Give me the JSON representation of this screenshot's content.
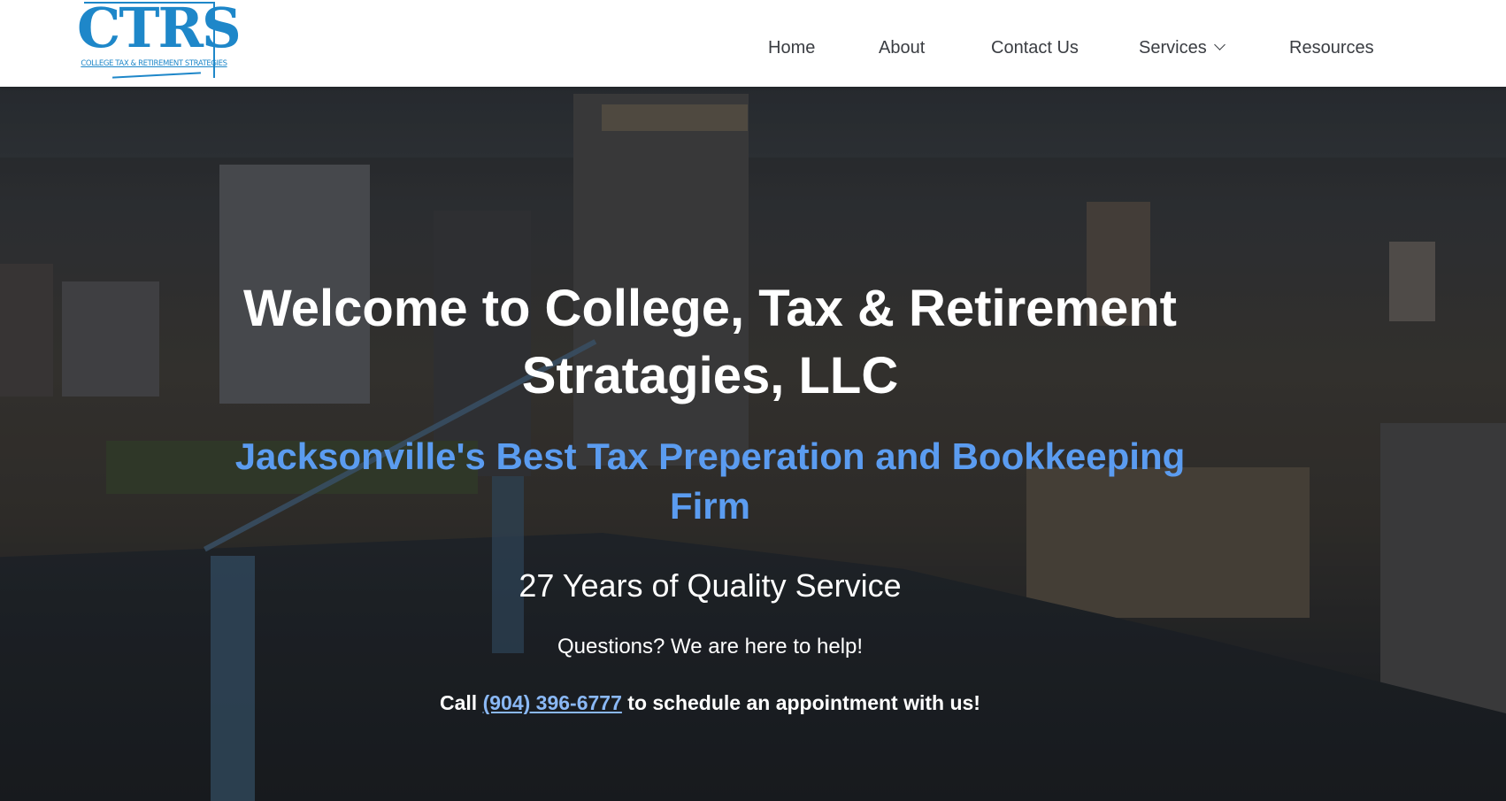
{
  "header": {
    "logo": {
      "text": "CTRS",
      "subtext": "COLLEGE TAX & RETIREMENT STRATEGIES"
    },
    "nav": [
      {
        "label": "Home"
      },
      {
        "label": "About"
      },
      {
        "label": "Contact Us"
      },
      {
        "label": "Services",
        "icon": "chevron-down-icon"
      },
      {
        "label": "Resources"
      }
    ]
  },
  "hero": {
    "title": "Welcome to College, Tax & Retirement Stratagies, LLC",
    "subtitle": "Jacksonville's Best Tax Preperation and Bookkeeping Firm",
    "years": "27 Years of Quality Service",
    "questions": "Questions? We are here to help!",
    "call_prefix": "Call",
    "phone": "(904) 396-6777",
    "call_suffix": "to schedule an appointment with us!"
  },
  "colors": {
    "brand": "#1e87c9",
    "subtitle": "#5b9cf0",
    "phone_link": "#8ab8f5"
  }
}
